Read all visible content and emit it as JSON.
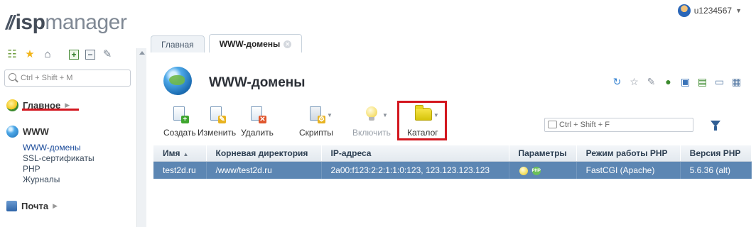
{
  "app": {
    "logo_isp": "isp",
    "logo_manager": "manager"
  },
  "user": {
    "name": "u1234567"
  },
  "tabs": [
    {
      "label": "Главная"
    },
    {
      "label": "WWW-домены"
    }
  ],
  "sidebar": {
    "search_placeholder": "Ctrl + Shift + M",
    "sections": {
      "main": {
        "label": "Главное"
      },
      "www": {
        "label": "WWW",
        "items": [
          "WWW-домены",
          "SSL-сертификаты",
          "PHP",
          "Журналы"
        ]
      },
      "mail": {
        "label": "Почта"
      }
    }
  },
  "main": {
    "title": "WWW-домены",
    "toolbar": {
      "create": "Создать",
      "edit": "Изменить",
      "delete": "Удалить",
      "scripts": "Скрипты",
      "enable": "Включить",
      "catalog": "Каталог"
    },
    "filter_placeholder": "Ctrl + Shift + F",
    "table": {
      "columns": [
        "Имя",
        "Корневая директория",
        "IP-адреса",
        "Параметры",
        "Режим работы PHP",
        "Версия PHP"
      ],
      "rows": [
        {
          "name": "test2d.ru",
          "root": "/www/test2d.ru",
          "ips": "2a00:f123:2:2:1:1:0:123, 123.123.123.123",
          "php_mode": "FastCGI (Apache)",
          "php_version": "5.6.36 (alt)"
        }
      ]
    }
  },
  "colors": {
    "accent": "#d3171f",
    "selected_row": "#5c86b3",
    "header_bg": "#e3e9ef"
  }
}
